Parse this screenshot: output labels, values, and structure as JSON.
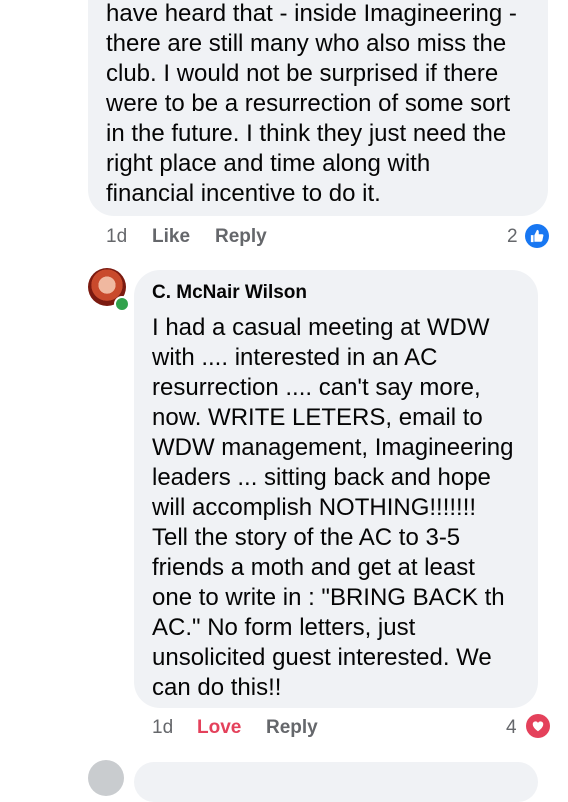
{
  "comment1": {
    "text": "have heard that - inside Imagineering -\nthere are still many who also miss the\nclub.  I would not be surprised if there\nwere to be a resurrection of some sort\nin the future.  I think they just need the\nright place and time along with\nfinancial incentive to do it.",
    "time": "1d",
    "like_label": "Like",
    "reply_label": "Reply",
    "reaction_count": "2",
    "reaction_icon": "like-thumb-icon",
    "reaction_color": "#1877f2"
  },
  "comment2": {
    "author": "C. McNair Wilson",
    "text": "I had a casual meeting at WDW\nwith .... interested in an AC\nresurrection .... can't say more,\nnow. WRITE LETERS, email to\nWDW management, Imagineering\nleaders ... sitting back and hope\nwill accomplish NOTHING!!!!!!!\nTell the story of the AC to 3-5\nfriends a moth and get at least\none to write in : \"BRING BACK th\nAC.\"  No form letters, just\nunsolicited guest interested. We\ncan do this!!",
    "time": "1d",
    "love_label": "Love",
    "reply_label": "Reply",
    "reaction_count": "4",
    "reaction_icon": "heart-icon",
    "reaction_color": "#e4415b"
  }
}
